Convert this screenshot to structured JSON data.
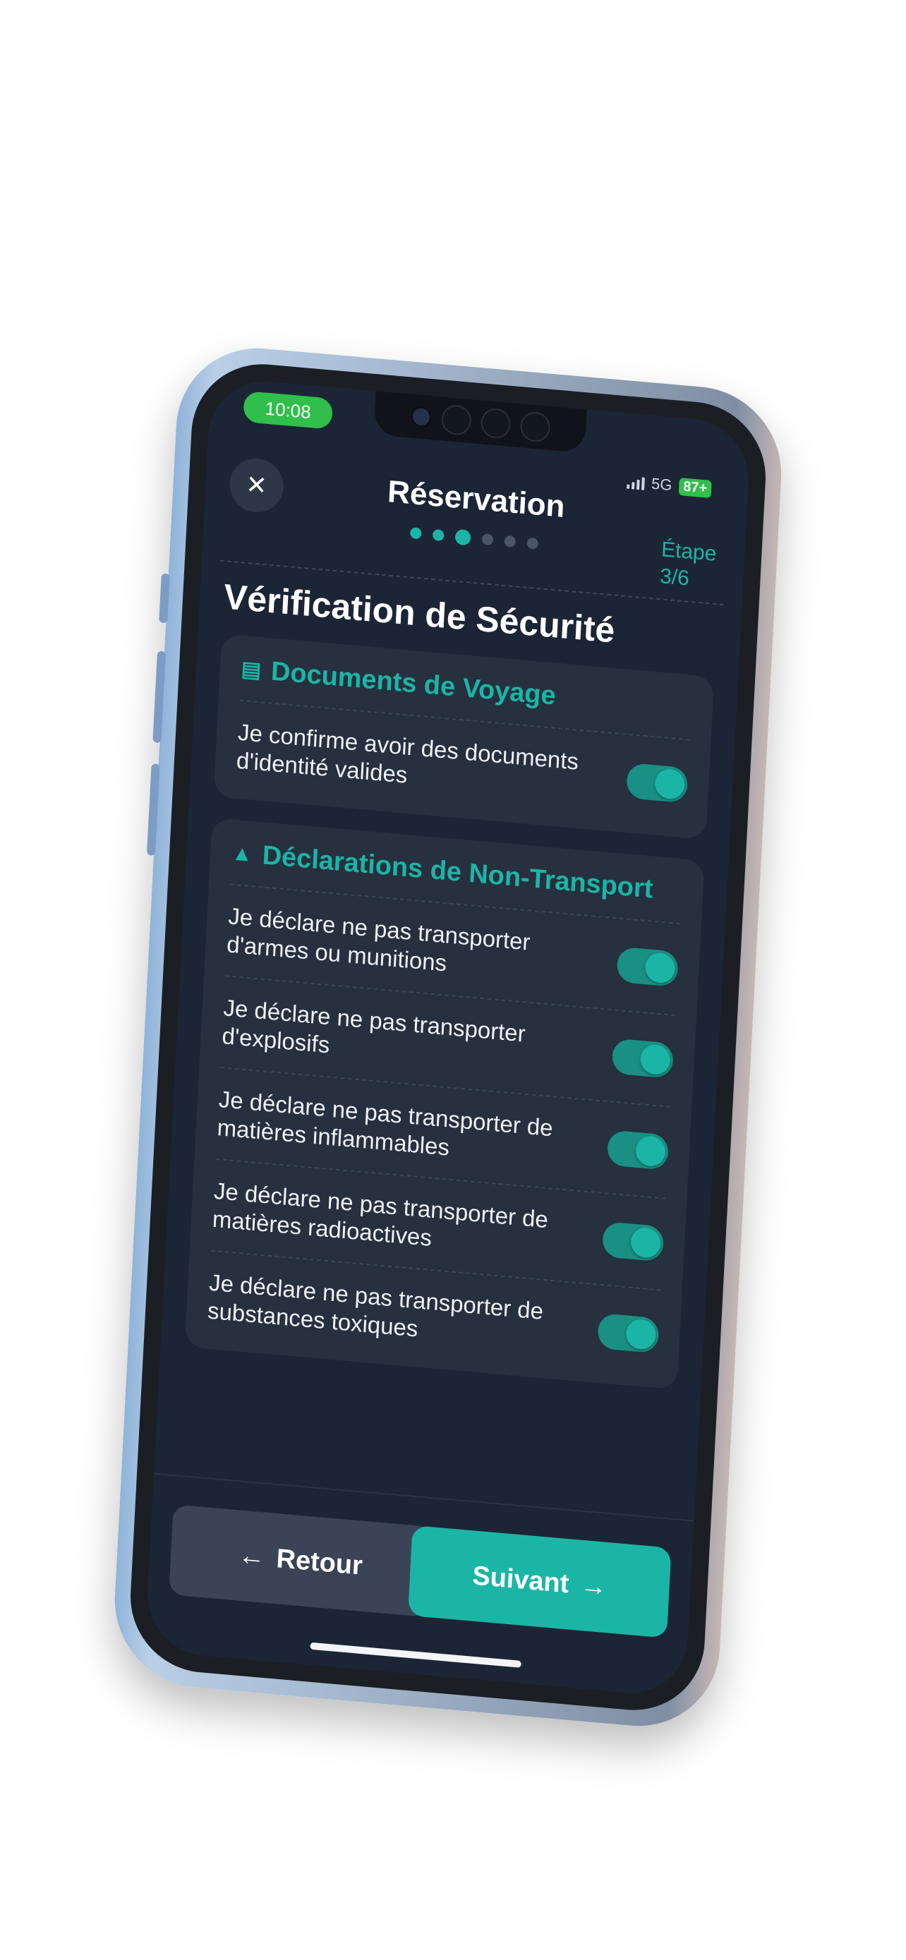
{
  "status_bar": {
    "time": "10:08",
    "network": "5G",
    "battery": "87+"
  },
  "header": {
    "title": "Réservation",
    "step_label": "Étape",
    "step_value": "3/6",
    "progress": {
      "current": 3,
      "total": 6
    }
  },
  "page_title": "Vérification de Sécurité",
  "sections": [
    {
      "title": "Documents de Voyage",
      "icon": "document-icon",
      "items": [
        {
          "label": "Je confirme avoir des documents d'identité valides",
          "checked": true
        }
      ]
    },
    {
      "title": "Déclarations de Non-Transport",
      "icon": "warning-icon",
      "items": [
        {
          "label": "Je déclare ne pas transporter d'armes ou munitions",
          "checked": true
        },
        {
          "label": "Je déclare ne pas transporter d'explosifs",
          "checked": true
        },
        {
          "label": "Je déclare ne pas transporter de matières inflammables",
          "checked": true
        },
        {
          "label": "Je déclare ne pas transporter de matières radioactives",
          "checked": true
        },
        {
          "label": "Je déclare ne pas transporter de substances toxiques",
          "checked": true
        }
      ]
    }
  ],
  "footer": {
    "back_label": "Retour",
    "next_label": "Suivant"
  },
  "colors": {
    "accent": "#1bb5a5",
    "background": "#1c2536",
    "card": "#26303f"
  }
}
